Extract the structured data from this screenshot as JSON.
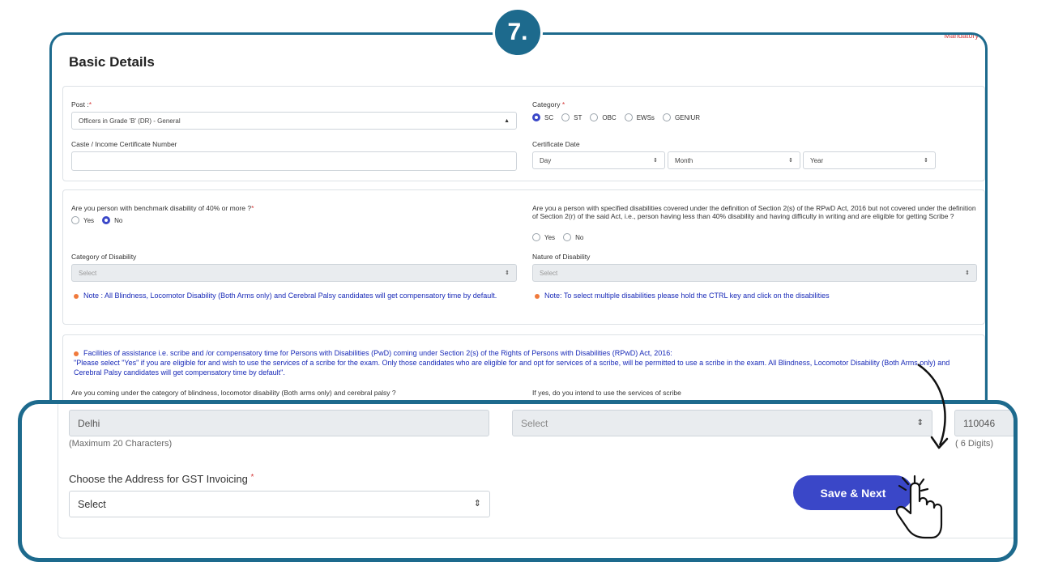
{
  "step_badge": "7.",
  "mandatory_note": "Mandatory *",
  "page_title": "Basic Details",
  "section1": {
    "post_label": "Post :",
    "post_value": "Officers in Grade 'B' (DR) - General",
    "category_label": "Category",
    "category_options": [
      "SC",
      "ST",
      "OBC",
      "EWSs",
      "GEN/UR"
    ],
    "category_selected": "SC",
    "caste_cert_label": "Caste / Income Certificate Number",
    "caste_cert_value": "",
    "cert_date_label": "Certificate Date",
    "day_value": "Day",
    "month_value": "Month",
    "year_value": "Year"
  },
  "section2": {
    "q1_label": "Are you person with benchmark disability of 40% or more ?",
    "q1_options": [
      "Yes",
      "No"
    ],
    "q1_selected": "No",
    "q2_label": "Are you a person with specified disabilities covered under the definition of Section 2(s) of the RPwD Act, 2016 but not covered under the definition of Section 2(r) of the said Act, i.e., person having less than 40% disability and having difficulty in writing and are eligible for getting Scribe ?",
    "q2_options": [
      "Yes",
      "No"
    ],
    "cat_disability_label": "Category of Disability",
    "cat_disability_value": "Select",
    "nature_disability_label": "Nature of Disability",
    "nature_disability_value": "Select",
    "note_left": "Note : All Blindness, Locomotor Disability (Both Arms only) and Cerebral Palsy candidates will get compensatory time by default.",
    "note_right": "Note: To select multiple disabilities please hold the CTRL key and click on the disabilities"
  },
  "section3": {
    "facilities_text": "Facilities of assistance i.e. scribe and /or compensatory time for Persons with Disabilities (PwD) coming under Section 2(s) of the Rights of Persons with Disabilities (RPwD) Act, 2016:",
    "scribe_text": "\"Please select \"Yes\" if you are eligible for and wish to use the services of a scribe for the exam. Only those candidates who are eligible for and opt for services of a scribe, will be permitted to use a scribe in the exam. All Blindness, Locomotor Disability (Both Arms only) and Cerebral Palsy candidates will get compensatory time by default\".",
    "q3_label": "Are you coming under the category of blindness, locomotor disability (Both arms only) and cerebral palsy ?",
    "q4_label": "If yes, do you intend to use the services of scribe"
  },
  "zoom": {
    "city_value": "Delhi",
    "city_help": "(Maximum 20 Characters)",
    "state_value": "Select",
    "pincode_value": "110046",
    "pincode_help": "( 6 Digits)",
    "gst_label": "Choose the Address for GST Invoicing",
    "gst_value": "Select",
    "save_label": "Save & Next"
  },
  "colors": {
    "frame": "#1d6a8d",
    "primary": "#3a47c8",
    "note_text": "#1a2bb8",
    "note_dot": "#f07a3c",
    "required": "#d43a3a"
  },
  "icons": [
    "sort-arrows-icon",
    "pointing-hand-cursor-icon",
    "curved-arrow-icon",
    "bullet-dot-icon"
  ]
}
